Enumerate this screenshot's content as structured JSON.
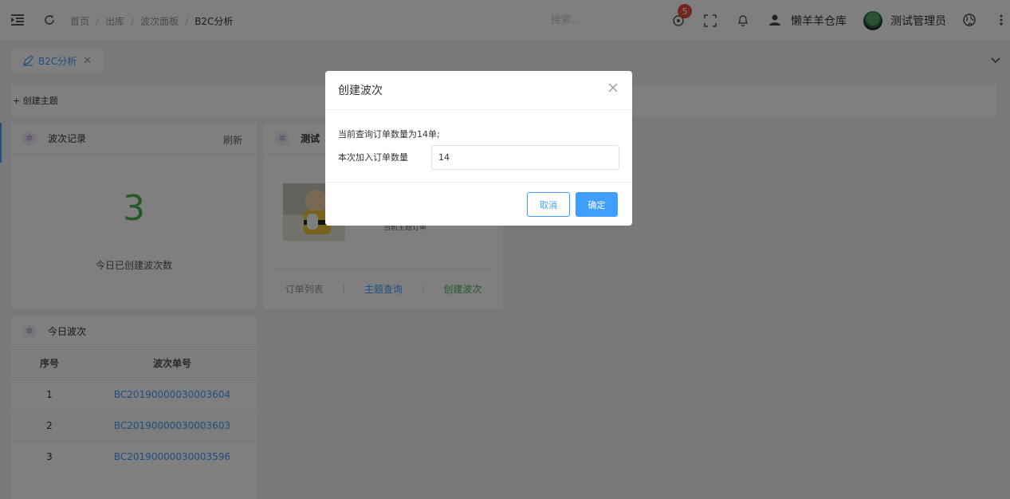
{
  "header": {
    "breadcrumb": [
      "首页",
      "出库",
      "波次面板",
      "B2C分析"
    ],
    "search_placeholder": "搜索...",
    "notification_count": "5",
    "warehouse": "懒羊羊仓库",
    "user": "测试管理员"
  },
  "tabs": [
    {
      "label": "B2C分析",
      "close": "✕"
    }
  ],
  "toolbar": {
    "create_theme": "+ 创建主题"
  },
  "wave_record": {
    "title": "波次记录",
    "refresh": "刷新",
    "count": "3",
    "caption": "今日已创建波次数"
  },
  "theme_card": {
    "title": "测试",
    "subtitle": "当前主题订单",
    "links": [
      "订单列表",
      "主题查询",
      "创建波次"
    ]
  },
  "today_waves": {
    "title": "今日波次",
    "columns": [
      "序号",
      "波次单号"
    ],
    "rows": [
      {
        "index": "1",
        "code": "BC20190000030003604"
      },
      {
        "index": "2",
        "code": "BC20190000030003603"
      },
      {
        "index": "3",
        "code": "BC20190000030003596"
      }
    ]
  },
  "modal": {
    "title": "创建波次",
    "info": "当前查询订单数量为14单;",
    "field_label": "本次加入订单数量",
    "field_value": "14",
    "cancel": "取消",
    "ok": "确定"
  },
  "colors": {
    "primary": "#409eff",
    "success": "#4caf50",
    "badge": "#e74c3c"
  }
}
